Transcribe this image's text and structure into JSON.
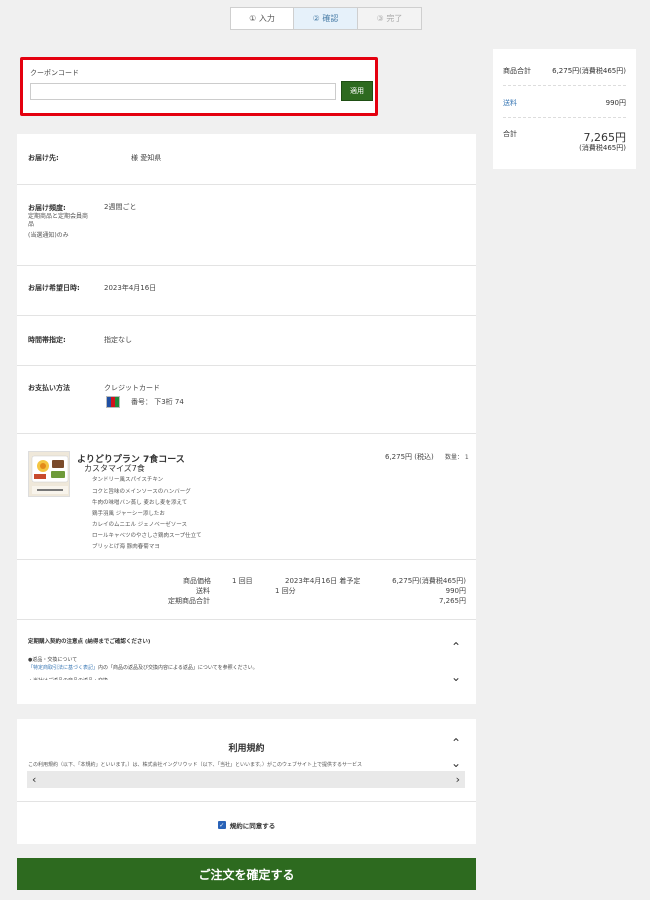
{
  "steps": [
    {
      "label": "① 入力"
    },
    {
      "label": "② 確認"
    },
    {
      "label": "③ 完了"
    }
  ],
  "coupon": {
    "label": "クーポンコード",
    "input_value": "",
    "apply_label": "適用",
    "highlight_color": "#e4000f"
  },
  "summary": {
    "subtotal_label": "商品合計",
    "subtotal_value": "6,275円(消費税465円)",
    "shipping_label": "送料",
    "shipping_value": "990円",
    "total_label": "合計",
    "total_value": "7,265円",
    "total_tax": "(消費税465円)"
  },
  "details": {
    "recipient_label": "お届け先:",
    "recipient_value": "様 愛知県",
    "frequency_label": "お届け頻度:",
    "frequency_note_1": "定期商品と定期会員商",
    "frequency_note_2": "品",
    "frequency_note_3": "(当選通知)のみ",
    "frequency_value": "2週間ごと",
    "date_label": "お届け希望日時:",
    "date_value": "2023年4月16日",
    "time_label": "時間帯指定:",
    "time_value": "指定なし",
    "payment_label": "お支払い方法",
    "payment_value": "クレジットカード",
    "card_value": "番号： 下3桁 74"
  },
  "product": {
    "title": "よりどりプラン 7食コース",
    "subtitle": "カスタマイズ7食",
    "price": "6,275円 (税込)",
    "qty": "数量： 1",
    "menu": [
      "タンドリー風スパイスチキン",
      "コクと旨味のメインソースのハンバーグ",
      "牛肉の味噌バン蒸し 麦おし麦を添えて",
      "鶏手羽風 ジャーシー添したお",
      "カレイのムニエル ジェノベーゼソース",
      "ロールキャベツのやさしさ鶏肉スープ仕立て",
      "ブリッとげ海 豚肉春菊マヨ"
    ]
  },
  "price_rows": {
    "item_label": "商品価格",
    "times": "1 回目",
    "date": "2023年4月16日 着予定",
    "item_value": "6,275円(消費税465円)",
    "shipping_label": "送料",
    "shipping_times": "1 回分",
    "shipping_value": "990円",
    "total_label": "定期商品合計",
    "total_value": "7,265円"
  },
  "notes": {
    "title": "定期購入契約の注意点 (納得までご確認ください)",
    "line1": "●返品・交換について",
    "line2_link": "「特定商取引法に基づく表記」",
    "line2_rest": "内の「商品の返品及び交換内容による返品」についてを参照ください。",
    "line3": "・当社はご返品の商品の返品・交換"
  },
  "terms": {
    "title": "利用規約",
    "text": "この利用規約（以下、「本規約」といいます。）は、株式会社イングリウッド（以下、「当社」といいます。）がこのウェブサイト上で提供するサービス",
    "agree_label": "規約に同意する"
  },
  "confirm_button": "ご注文を確定する",
  "colors": {
    "primary_green": "#2d6a1f",
    "link_blue": "#3a78b5"
  }
}
